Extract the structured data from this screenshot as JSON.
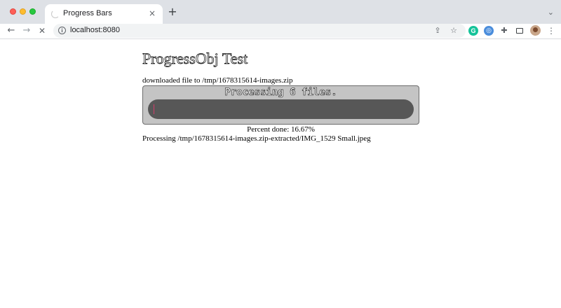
{
  "browser": {
    "tab": {
      "title": "Progress Bars",
      "close_glyph": "×"
    },
    "new_tab_glyph": "+",
    "tab_list_glyph": "⌄",
    "nav": {
      "back_glyph": "←",
      "forward_glyph": "→",
      "stop_glyph": "✕"
    },
    "omnibox": {
      "info_glyph": "i",
      "url": "localhost:8080",
      "share_glyph": "⇪",
      "star_glyph": "☆"
    },
    "extensions": {
      "grammarly_glyph": "G",
      "blue_ext_glyph": "◎",
      "puzzle_glyph": "✚"
    },
    "menu_glyph": "⋮",
    "colors": {
      "titlebar": "#dee1e6",
      "close": "#ff5f57",
      "minimize": "#febc2e",
      "maximize": "#28c840"
    }
  },
  "page": {
    "title": "ProgressObj Test",
    "download_line": "downloaded file to /tmp/1678315614-images.zip",
    "progress": {
      "label": "Processing 6 files.",
      "fraction": 0.0,
      "colors": {
        "panel": "#c4c4c4",
        "track": "#575757",
        "cursor": "#d33c6a"
      }
    },
    "percent_line": "Percent done: 16.67%",
    "processing_line": "Processing /tmp/1678315614-images.zip-extracted/IMG_1529 Small.jpeg"
  }
}
